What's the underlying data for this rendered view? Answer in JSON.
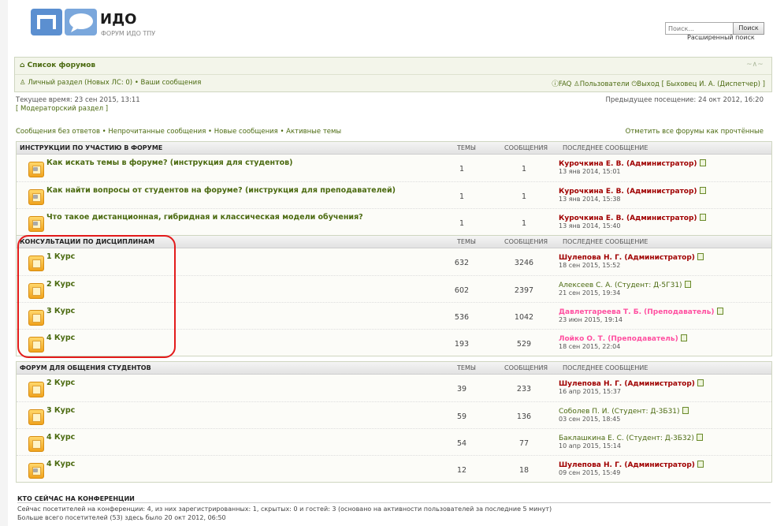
{
  "header": {
    "title": "ИДО",
    "description": "ФОРУМ ИДО ТПУ",
    "search_placeholder": "Поиск...",
    "search_button": "Поиск",
    "advanced_search": "Расширенный поиск"
  },
  "nav": {
    "forum_index": "Список форумов",
    "private": "Личный раздел (Новых ЛС: 0)",
    "bullet": "•",
    "your_posts": "Ваши сообщения",
    "faq": "FAQ",
    "members": "Пользователи",
    "logout": "Выход [ Быховец И. А. (Диспетчер) ]"
  },
  "status": {
    "current_time": "Текущее время: 23 сен 2015, 13:11",
    "mod_panel": "[ Модераторский раздел ]",
    "last_visit": "Предыдущее посещение: 24 окт 2012, 16:20",
    "quick_links": "Сообщения без ответов • Непрочитанные сообщения • Новые сообщения • Активные темы",
    "mark_read": "Отметить все форумы как прочтённые"
  },
  "columns": {
    "topics": "ТЕМЫ",
    "posts": "СООБЩЕНИЯ",
    "last_post": "ПОСЛЕДНЕЕ СООБЩЕНИЕ"
  },
  "sections": [
    {
      "title": "ИНСТРУКЦИИ ПО УЧАСТИЮ В ФОРУМЕ",
      "forums": [
        {
          "name": "Как искать темы в форуме? (инструкция для студентов)",
          "topics": "1",
          "posts": "1",
          "last_user": "Курочкина Е. В. (Администратор)",
          "last_date": "13 янв 2014, 15:01",
          "role": "admin",
          "locked": true
        },
        {
          "name": "Как найти вопросы от студентов на форуме? (инструкция для преподавателей)",
          "topics": "1",
          "posts": "1",
          "last_user": "Курочкина Е. В. (Администратор)",
          "last_date": "13 янв 2014, 15:38",
          "role": "admin",
          "locked": true
        },
        {
          "name": "Что такое дистанционная, гибридная и классическая модели обучения?",
          "topics": "1",
          "posts": "1",
          "last_user": "Курочкина Е. В. (Администратор)",
          "last_date": "13 янв 2014, 15:40",
          "role": "admin",
          "locked": true
        }
      ]
    },
    {
      "title": "КОНСУЛЬТАЦИИ ПО ДИСЦИПЛИНАМ",
      "forums": [
        {
          "name": "1 Курс",
          "topics": "632",
          "posts": "3246",
          "last_user": "Шулепова Н. Г. (Администратор)",
          "last_date": "18 сен 2015, 15:52",
          "role": "admin",
          "locked": false
        },
        {
          "name": "2 Курс",
          "topics": "602",
          "posts": "2397",
          "last_user": "Алексеев С. А. (Студент: Д-5Г31)",
          "last_date": "21 сен 2015, 19:34",
          "role": "student",
          "locked": false
        },
        {
          "name": "3 Курс",
          "topics": "536",
          "posts": "1042",
          "last_user": "Давлетгареева Т. Б. (Преподаватель)",
          "last_date": "23 июн 2015, 19:14",
          "role": "teacher",
          "locked": false
        },
        {
          "name": "4 Курс",
          "topics": "193",
          "posts": "529",
          "last_user": "Лойко О. Т. (Преподаватель)",
          "last_date": "18 сен 2015, 22:04",
          "role": "teacher",
          "locked": false
        }
      ]
    },
    {
      "title": "ФОРУМ ДЛЯ ОБЩЕНИЯ СТУДЕНТОВ",
      "forums": [
        {
          "name": "2 Курс",
          "topics": "39",
          "posts": "233",
          "last_user": "Шулепова Н. Г. (Администратор)",
          "last_date": "16 апр 2015, 15:37",
          "role": "admin",
          "locked": false
        },
        {
          "name": "3 Курс",
          "topics": "59",
          "posts": "136",
          "last_user": "Соболев П. И. (Студент: Д-3Б31)",
          "last_date": "03 сен 2015, 18:45",
          "role": "student",
          "locked": false
        },
        {
          "name": "4 Курс",
          "topics": "54",
          "posts": "77",
          "last_user": "Баклашкина Е. С. (Студент: Д-3Б32)",
          "last_date": "10 апр 2015, 15:14",
          "role": "student",
          "locked": false
        },
        {
          "name": "4 Курс",
          "topics": "12",
          "posts": "18",
          "last_user": "Шулепова Н. Г. (Администратор)",
          "last_date": "09 сен 2015, 15:49",
          "role": "admin",
          "locked": true
        }
      ]
    }
  ],
  "who": {
    "title": "КТО СЕЙЧАС НА КОНФЕРЕНЦИИ",
    "line1": "Сейчас посетителей на конференции: 4, из них зарегистрированных: 1, скрытых: 0 и гостей: 3 (основано на активности пользователей за последние 5 минут)",
    "line2": "Больше всего посетителей (53) здесь было 20 окт 2012, 06:50"
  }
}
